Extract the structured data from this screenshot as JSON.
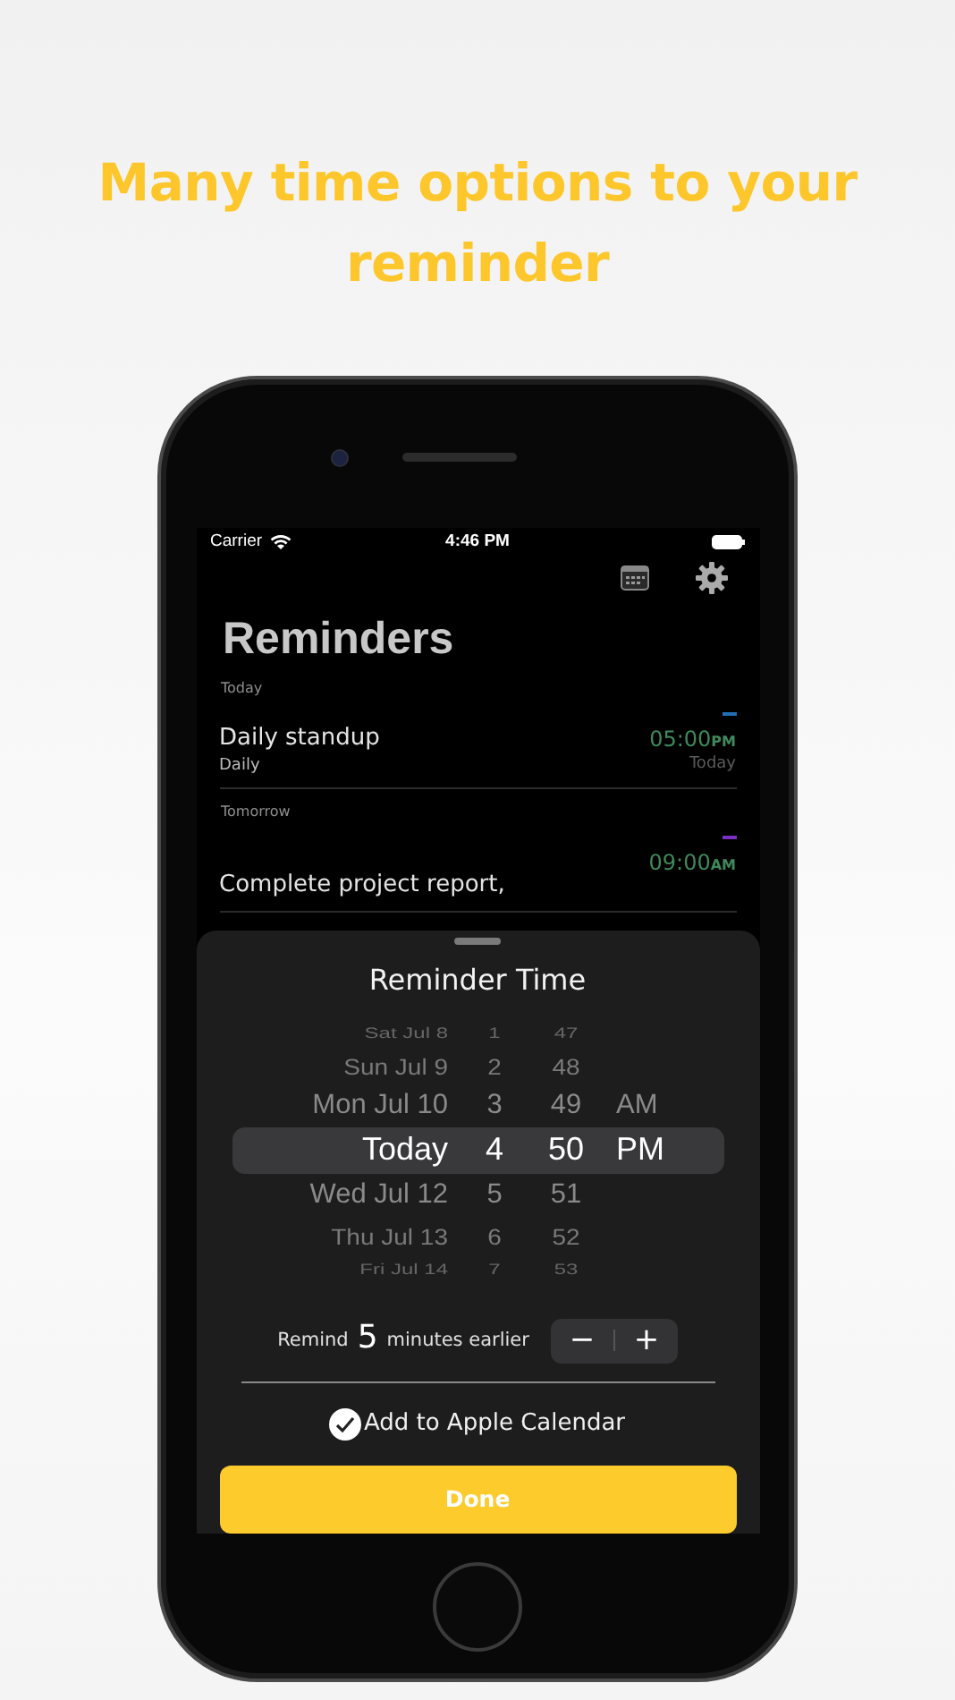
{
  "headline": "Many time options to your reminder",
  "status_bar": {
    "carrier": "Carrier",
    "time": "4:46 PM"
  },
  "title": "Reminders",
  "sections": [
    {
      "title": "Today",
      "items": [
        {
          "title": "Daily standup",
          "subtitle": "Daily",
          "time": "05:00",
          "period": "PM",
          "day": "Today",
          "color": "#1f6fb8"
        }
      ]
    },
    {
      "title": "Tomorrow",
      "items": [
        {
          "title": "Complete project report,",
          "time": "09:00",
          "period": "AM",
          "color": "#7b2fc4"
        }
      ]
    }
  ],
  "sheet": {
    "title": "Reminder Time",
    "picker_rows": [
      {
        "date": "Sat Jul 8",
        "hour": "1",
        "minute": "47",
        "selected": false
      },
      {
        "date": "Sun Jul 9",
        "hour": "2",
        "minute": "48",
        "selected": false
      },
      {
        "date": "Mon Jul 10",
        "hour": "3",
        "minute": "49",
        "period": "AM",
        "selected": false
      },
      {
        "date": "Today",
        "hour": "4",
        "minute": "50",
        "period": "PM",
        "selected": true
      },
      {
        "date": "Wed Jul 12",
        "hour": "5",
        "minute": "51",
        "selected": false
      },
      {
        "date": "Thu Jul 13",
        "hour": "6",
        "minute": "52",
        "selected": false
      },
      {
        "date": "Fri Jul 14",
        "hour": "7",
        "minute": "53",
        "selected": false
      }
    ],
    "remind": {
      "before": "Remind",
      "count": "5",
      "after": "minutes earlier",
      "minus": "−",
      "plus": "+"
    },
    "calendar_option": {
      "label": "Add to Apple Calendar",
      "checked": true
    },
    "done": "Done"
  }
}
